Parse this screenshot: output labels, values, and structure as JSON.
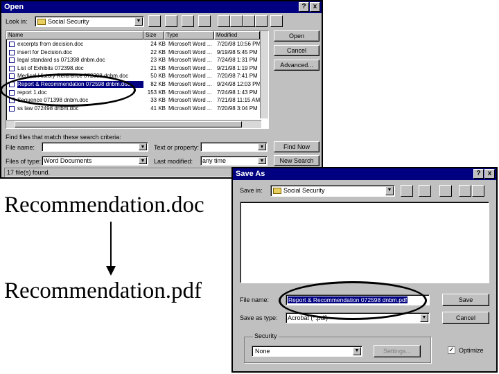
{
  "open_dialog": {
    "title": "Open",
    "look_in_label": "Look in:",
    "look_in_value": "Social Security",
    "columns": [
      "Name",
      "Size",
      "Type",
      "Modified"
    ],
    "files": [
      {
        "name": "excerpts from decision.doc",
        "size": "24 KB",
        "type": "Microsoft Word ...",
        "modified": "7/20/98 10:56 PM"
      },
      {
        "name": "insert for Decision.doc",
        "size": "22 KB",
        "type": "Microsoft Word ...",
        "modified": "9/19/98 5:45 PM"
      },
      {
        "name": "legal standard ss 071398 dnbm.doc",
        "size": "23 KB",
        "type": "Microsoft Word ...",
        "modified": "7/24/98 1:31 PM"
      },
      {
        "name": "List of Exhibits 072398.doc",
        "size": "21 KB",
        "type": "Microsoft Word ...",
        "modified": "9/21/98 1:19 PM"
      },
      {
        "name": "Medical History Reference 072398 dnbm.doc",
        "size": "50 KB",
        "type": "Microsoft Word ...",
        "modified": "7/20/98 7:41 PM"
      },
      {
        "name": "Report & Recommendation 072598 dnbm.doc",
        "size": "82 KB",
        "type": "Microsoft Word ...",
        "modified": "9/24/98 12:03 PM"
      },
      {
        "name": "report 1.doc",
        "size": "153 KB",
        "type": "Microsoft Word ...",
        "modified": "7/24/98 1:43 PM"
      },
      {
        "name": "Sequence 071398 dnbm.doc",
        "size": "33 KB",
        "type": "Microsoft Word ...",
        "modified": "7/21/98 11:15 AM"
      },
      {
        "name": "ss law 072498 dnbm.doc",
        "size": "41 KB",
        "type": "Microsoft Word ...",
        "modified": "7/20/98 3:04 PM"
      }
    ],
    "open_button": "Open",
    "cancel_button": "Cancel",
    "advanced_button": "Advanced...",
    "find_caption": "Find files that match these search criteria:",
    "file_name_label": "File name:",
    "file_name_value": "",
    "text_prop_label": "Text or property:",
    "text_prop_value": "",
    "files_of_type_label": "Files of type:",
    "files_of_type_value": "Word Documents",
    "last_modified_label": "Last modified:",
    "last_modified_value": "any time",
    "find_now_button": "Find Now",
    "new_search_button": "New Search",
    "status": "17 file(s) found."
  },
  "save_dialog": {
    "title": "Save As",
    "help_btn": "?",
    "close_btn": "x",
    "save_in_label": "Save in:",
    "save_in_value": "Social Security",
    "file_name_label": "File name:",
    "file_name_value": "Report & Recommendation 072598 dnbm.pdf",
    "save_as_type_label": "Save as type:",
    "save_as_type_value": "Acrobat (*.pdf)",
    "save_button": "Save",
    "cancel_button": "Cancel",
    "security_label": "Security",
    "security_value": "None",
    "settings_button": "Settings...",
    "optimize_label": "Optimize",
    "optimize_checked": true
  },
  "open_title_help": "?",
  "open_title_close": "x",
  "caption_doc": "Recommendation.doc",
  "caption_pdf": "Recommendation.pdf"
}
